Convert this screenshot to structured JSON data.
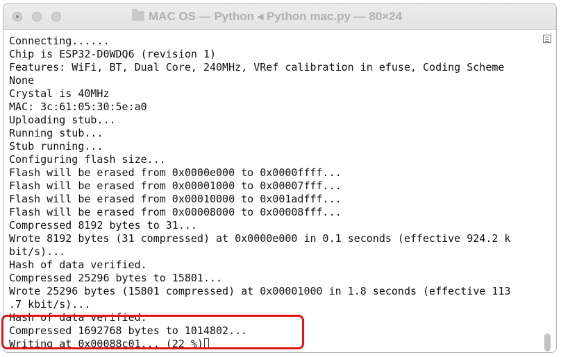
{
  "window": {
    "title": "MAC OS — Python ◂ Python mac.py — 80×24"
  },
  "terminal": {
    "lines": [
      "Connecting......",
      "Chip is ESP32-D0WDQ6 (revision 1)",
      "Features: WiFi, BT, Dual Core, 240MHz, VRef calibration in efuse, Coding Scheme",
      "None",
      "Crystal is 40MHz",
      "MAC: 3c:61:05:30:5e:a0",
      "Uploading stub...",
      "Running stub...",
      "Stub running...",
      "Configuring flash size...",
      "Flash will be erased from 0x0000e000 to 0x0000ffff...",
      "Flash will be erased from 0x00001000 to 0x00007fff...",
      "Flash will be erased from 0x00010000 to 0x001adfff...",
      "Flash will be erased from 0x00008000 to 0x00008fff...",
      "Compressed 8192 bytes to 31...",
      "Wrote 8192 bytes (31 compressed) at 0x0000e000 in 0.1 seconds (effective 924.2 k",
      "bit/s)...",
      "Hash of data verified.",
      "Compressed 25296 bytes to 15801...",
      "Wrote 25296 bytes (15801 compressed) at 0x00001000 in 1.8 seconds (effective 113",
      ".7 kbit/s)...",
      "Hash of data verified.",
      "Compressed 1692768 bytes to 1014802...",
      "Writing at 0x00088c01... (22 %)"
    ]
  },
  "icons": {
    "close": "close-button",
    "minimize": "minimize-button",
    "zoom": "zoom-button",
    "folder": "folder-icon",
    "scroll_menu": "menu-lines-icon"
  },
  "colors": {
    "highlight": "#e01414",
    "text": "#111111",
    "title": "#b0b0b0"
  }
}
